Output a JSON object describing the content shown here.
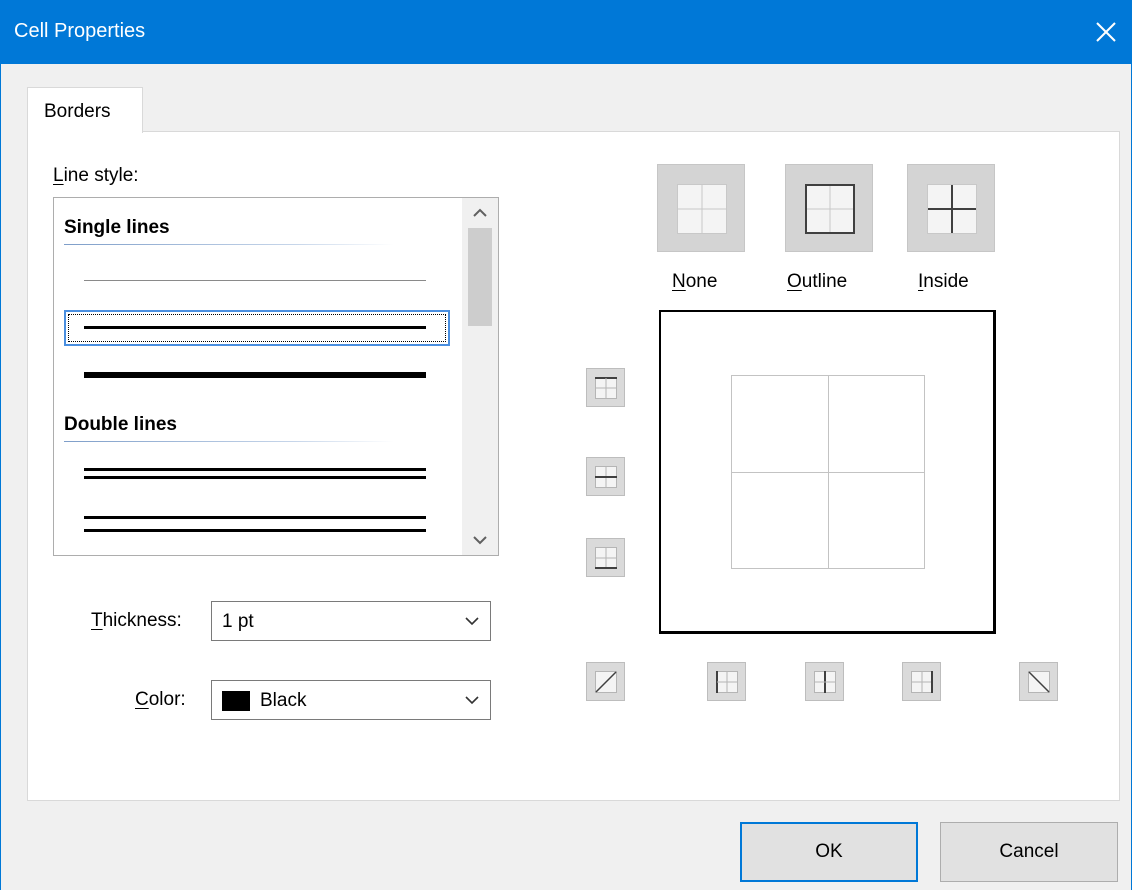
{
  "window": {
    "title": "Cell Properties",
    "close_icon": "close-icon"
  },
  "tabs": [
    {
      "label": "Borders",
      "active": true
    }
  ],
  "line_style": {
    "label_prefix": "L",
    "label_rest": "ine style:",
    "groups": [
      {
        "heading": "Single lines"
      },
      {
        "heading": "Double lines"
      }
    ],
    "selected_index": 1
  },
  "thickness": {
    "label_prefix": "T",
    "label_rest": "hickness:",
    "value": "1 pt"
  },
  "color": {
    "label_prefix": "C",
    "label_rest": "olor:",
    "value": "Black",
    "swatch": "#000000"
  },
  "presets": [
    {
      "prefix": "N",
      "rest": "one"
    },
    {
      "prefix": "O",
      "rest": "utline"
    },
    {
      "prefix": "I",
      "rest": "nside"
    }
  ],
  "buttons": {
    "ok": "OK",
    "cancel": "Cancel"
  },
  "colors": {
    "titlebar": "#0078d7",
    "accent": "#0078d7",
    "selection": "#4a8fe0"
  }
}
